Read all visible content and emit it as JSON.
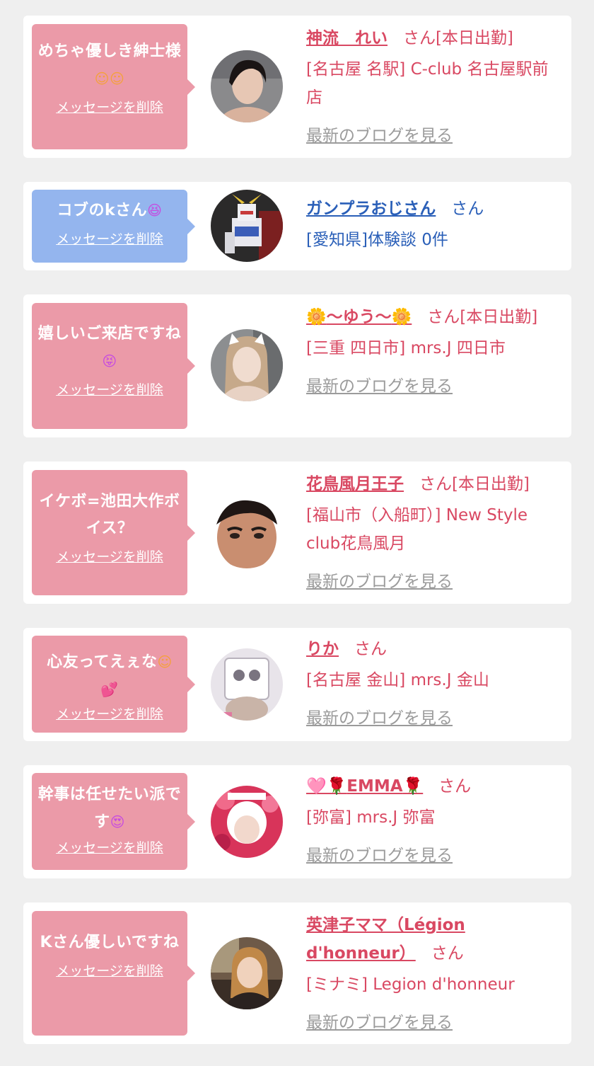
{
  "common": {
    "delete_label": "メッセージを削除",
    "blog_label": "最新のブログを見る"
  },
  "cards": [
    {
      "message": "めちゃ優しき紳士様",
      "message_emoji": "☺☺",
      "name": "神流　れい",
      "suffix": "さん[本日出勤]",
      "shop": "[名古屋 名駅] C-club 名古屋駅前店"
    },
    {
      "message": "コブのkさん",
      "message_emoji": "😆",
      "name": "ガンプラおじさん",
      "suffix": "さん",
      "shop": "[愛知県]体験談 0件"
    },
    {
      "message": "嬉しいご来店ですね",
      "message_emoji": "😝",
      "name_prefix_emoji": "🌼",
      "name": "〜ゆう〜",
      "name_suffix_emoji": "🌼",
      "suffix": "さん[本日出勤]",
      "shop": "[三重 四日市] mrs.J 四日市"
    },
    {
      "message": "イケボ=池田大作ボイス？",
      "name": "花鳥風月王子",
      "suffix": "さん[本日出勤]",
      "shop": "[福山市（入船町）] New Style club花鳥風月"
    },
    {
      "message": "心友ってえぇな",
      "message_emoji": "☺",
      "message_emoji2": "💕",
      "name": "りか",
      "suffix": "さん",
      "shop": "[名古屋 金山] mrs.J 金山"
    },
    {
      "message": "幹事は任せたい派です",
      "message_emoji": "😍",
      "name_prefix_emoji": "🩷🌹",
      "name": "EMMA",
      "name_suffix_emoji": "🌹",
      "suffix": "さん",
      "shop": "[弥富] mrs.J 弥富"
    },
    {
      "message": "Kさん優しいですね",
      "name": "英津子ママ（Légion d'honneur）",
      "suffix": "さん",
      "shop": "[ミナミ] Legion d'honneur"
    }
  ],
  "colors": {
    "pink_bubble": "#eb9aa8",
    "blue_bubble": "#94b5ee",
    "pink_text": "#d94862",
    "blue_text": "#2a5fb8",
    "blog_link": "#9b9b9b"
  }
}
